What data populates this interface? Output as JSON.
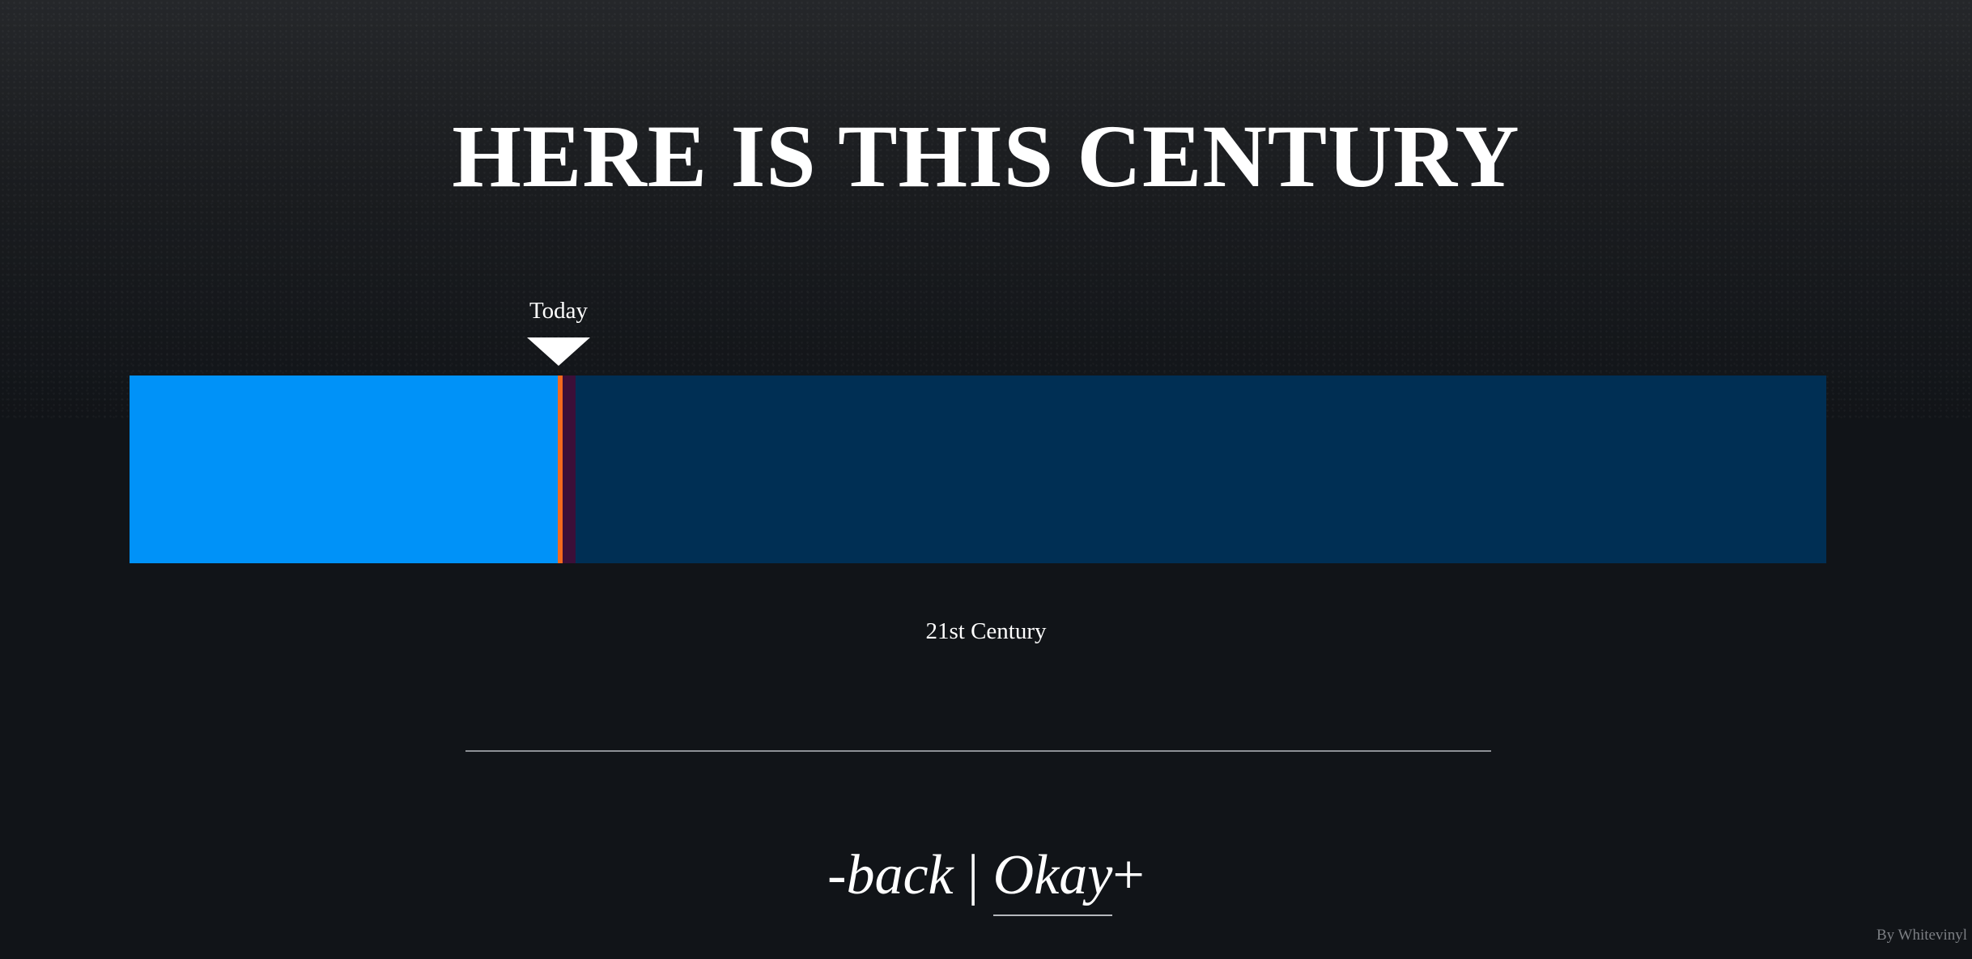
{
  "page": {
    "title": "HERE IS THIS CENTURY",
    "credit": "By Whitevinyl"
  },
  "timeline": {
    "marker_label": "Today",
    "century_label": "21st Century",
    "elapsed_fraction": 0.254,
    "colors": {
      "elapsed": "#0092f8",
      "remaining": "#002f54",
      "marker": "#f36a1e",
      "marker_shadow": "#3c0f38"
    }
  },
  "nav": {
    "back_prefix": "- ",
    "back_label": "back",
    "separator": "|",
    "okay_label": "Okay",
    "plus_suffix": " +"
  }
}
